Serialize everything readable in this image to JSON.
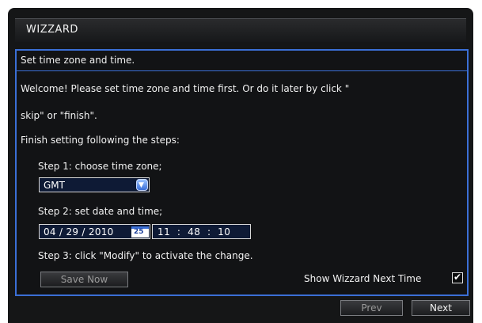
{
  "window": {
    "title": "WIZZARD"
  },
  "content": {
    "heading": "Set time zone and time.",
    "welcome_line1": "Welcome! Please set time zone and time first. Or do it later by click \"",
    "welcome_line2": "skip\" or \"finish\".",
    "finish_text": "Finish setting following the steps:",
    "step1_label": "Step 1: choose time zone;",
    "timezone_value": "GMT",
    "step2_label": "Step 2: set date and time;",
    "date_value": "04 / 29 / 2010",
    "calendar_day": "25",
    "time_value": "11  :  48  :  10",
    "step3_label": "Step 3: click \"Modify\" to activate the change.",
    "save_now_label": "Save Now",
    "show_next_time_label": "Show Wizzard Next Time",
    "show_next_time_checked": true
  },
  "footer": {
    "prev_label": "Prev",
    "next_label": "Next"
  },
  "colors": {
    "accent": "#3b6fd6",
    "background": "#151617",
    "text": "#f1f1f1"
  },
  "icons": {
    "dropdown": "chevron-down-icon",
    "calendar": "calendar-icon",
    "check": "checkmark-icon"
  }
}
